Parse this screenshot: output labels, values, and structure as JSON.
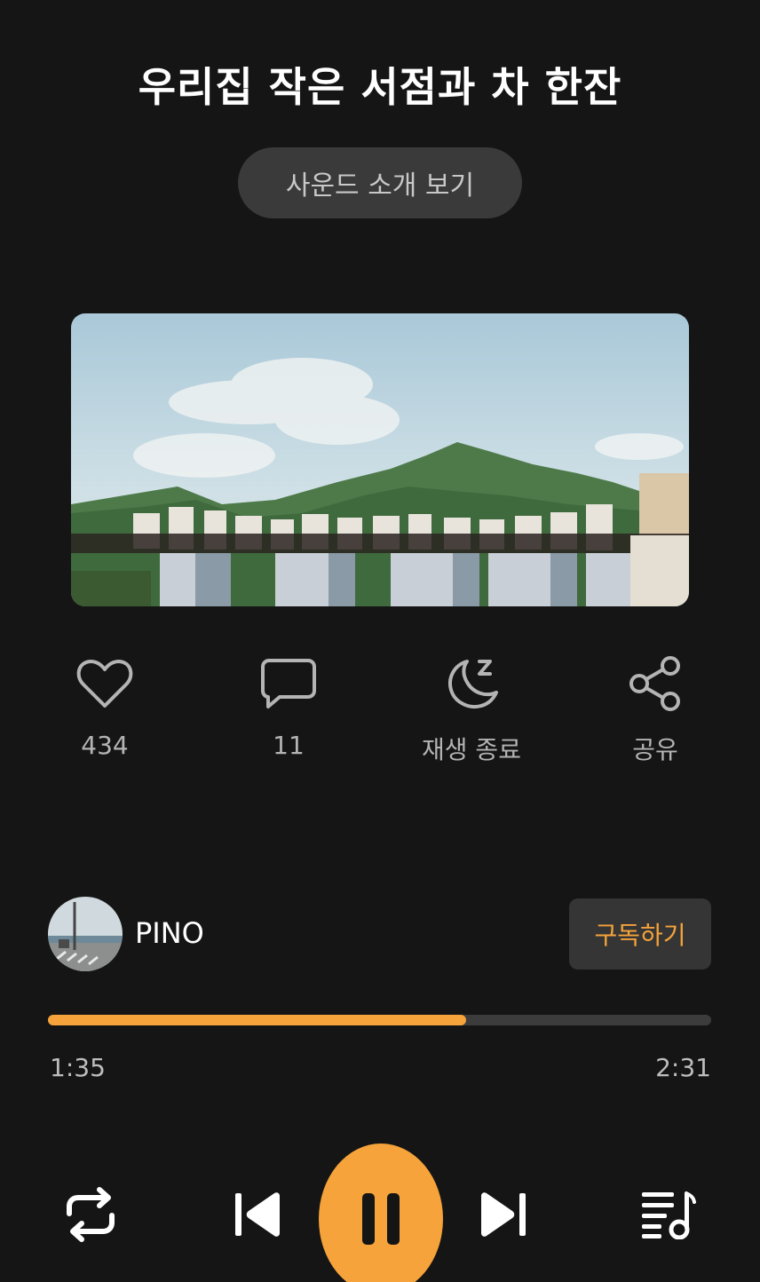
{
  "header": {
    "title": "우리집 작은 서점과 차 한잔",
    "intro_button": "사운드 소개 보기"
  },
  "actions": [
    {
      "icon": "heart-icon",
      "label": "434"
    },
    {
      "icon": "comment-icon",
      "label": "11"
    },
    {
      "icon": "moon-icon",
      "label": "재생 종료"
    },
    {
      "icon": "share-icon",
      "label": "공유"
    }
  ],
  "channel": {
    "name": "PINO",
    "subscribe_label": "구독하기"
  },
  "player": {
    "current_time": "1:35",
    "total_time": "2:31",
    "progress_fraction": 0.63
  },
  "controls": {
    "repeat": "repeat-icon",
    "previous": "skip-previous-icon",
    "play_pause": "pause-icon",
    "next": "skip-next-icon",
    "playlist": "playlist-icon"
  },
  "colors": {
    "accent": "#f5a33a",
    "background": "#151515"
  }
}
